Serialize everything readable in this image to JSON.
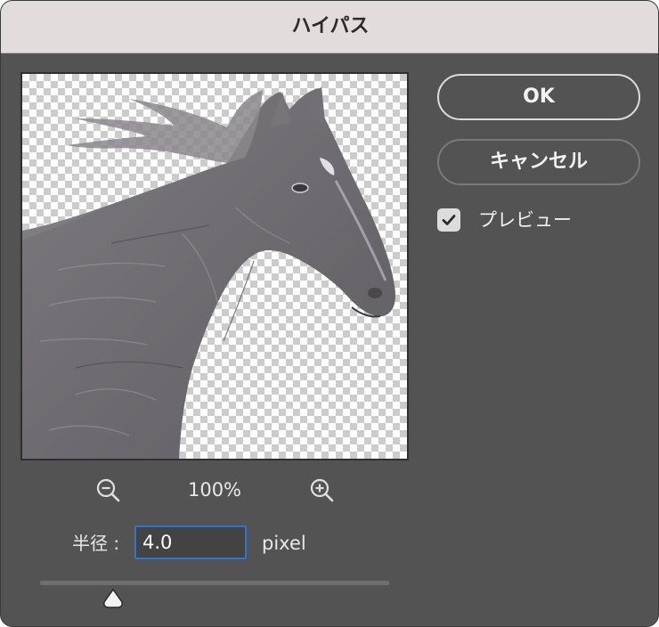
{
  "window": {
    "title": "ハイパス"
  },
  "preview": {
    "subject": "horse-high-pass-preview"
  },
  "zoom": {
    "level": "100%",
    "zoom_out_icon": "zoom-out-icon",
    "zoom_in_icon": "zoom-in-icon"
  },
  "radius": {
    "label": "半径 :",
    "value": "4.0",
    "unit": "pixel"
  },
  "slider": {
    "value_fraction": 0.21
  },
  "buttons": {
    "ok_label": "OK",
    "cancel_label": "キャンセル"
  },
  "preview_toggle": {
    "label": "プレビュー",
    "checked": true
  },
  "colors": {
    "dialog_bg": "#535353",
    "titlebar_bg": "#e3dcdc",
    "input_focus": "#2f74d0"
  }
}
